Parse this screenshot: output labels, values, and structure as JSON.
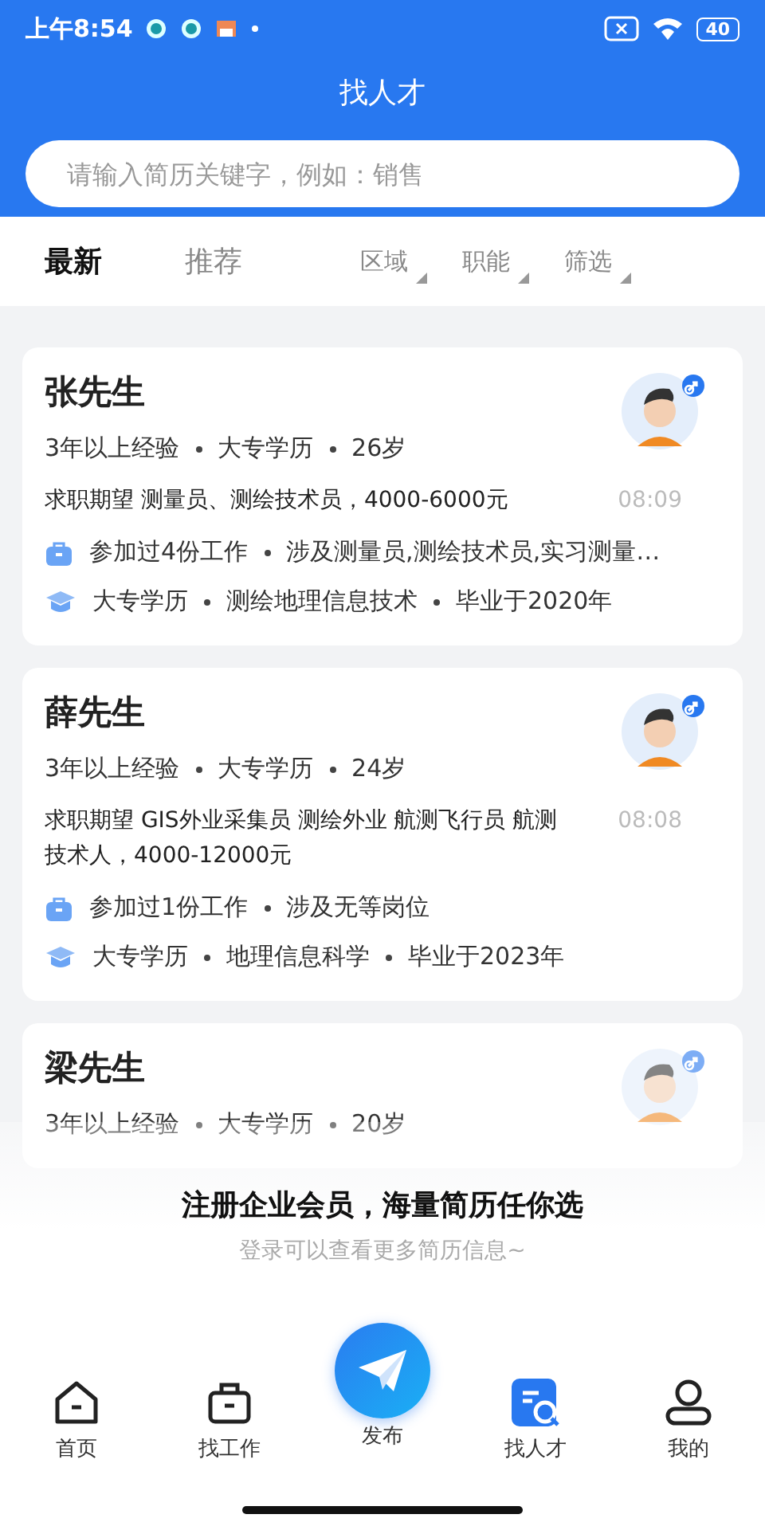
{
  "status_bar": {
    "time": "上午8:54",
    "battery": "40"
  },
  "header": {
    "title": "找人才"
  },
  "search": {
    "placeholder": "请输入简历关键字，例如：销售"
  },
  "tabs": [
    {
      "label": "最新",
      "selected": true
    },
    {
      "label": "推荐",
      "selected": false
    }
  ],
  "filters": [
    "区域",
    "职能",
    "筛选"
  ],
  "candidates": [
    {
      "name": "张先生",
      "meta": [
        "3年以上经验",
        "大专学历",
        "26岁"
      ],
      "expectation": "求职期望 测量员、测绘技术员，4000-6000元",
      "time": "08:09",
      "work": [
        "参加过4份工作",
        "涉及测量员,测绘技术员,实习测量…"
      ],
      "education": [
        "大专学历",
        "测绘地理信息技术",
        "毕业于2020年"
      ]
    },
    {
      "name": "薛先生",
      "meta": [
        "3年以上经验",
        "大专学历",
        "24岁"
      ],
      "expectation": "求职期望 GIS外业采集员 测绘外业 航测飞行员 航测技术人，4000-12000元",
      "time": "08:08",
      "work": [
        "参加过1份工作",
        "涉及无等岗位"
      ],
      "education": [
        "大专学历",
        "地理信息科学",
        "毕业于2023年"
      ]
    },
    {
      "name": "梁先生",
      "meta": [
        "3年以上经验",
        "大专学历",
        "20岁"
      ]
    }
  ],
  "promo": {
    "title": "注册企业会员，海量简历任你选",
    "hint": "登录可以查看更多简历信息~"
  },
  "nav": [
    {
      "kind": "home",
      "label": "首页",
      "selected": false
    },
    {
      "kind": "jobs",
      "label": "找工作",
      "selected": false
    },
    {
      "kind": "publish",
      "label": "发布"
    },
    {
      "kind": "talent",
      "label": "找人才",
      "selected": true
    },
    {
      "kind": "me",
      "label": "我的",
      "selected": false
    }
  ]
}
